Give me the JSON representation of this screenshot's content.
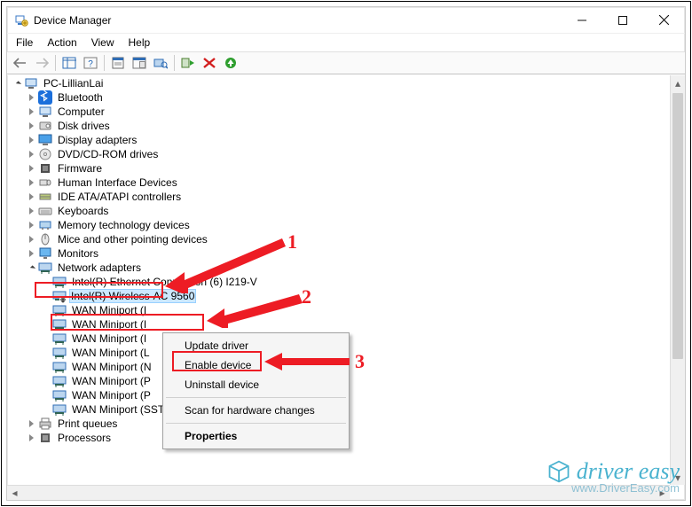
{
  "window": {
    "title": "Device Manager"
  },
  "menu": {
    "file": "File",
    "action": "Action",
    "view": "View",
    "help": "Help"
  },
  "tree": {
    "root": "PC-LillianLai",
    "cats": [
      "Bluetooth",
      "Computer",
      "Disk drives",
      "Display adapters",
      "DVD/CD-ROM drives",
      "Firmware",
      "Human Interface Devices",
      "IDE ATA/ATAPI controllers",
      "Keyboards",
      "Memory technology devices",
      "Mice and other pointing devices",
      "Monitors"
    ],
    "net_label": "Network adapters",
    "net_children": [
      "Intel(R) Ethernet Connection (6) I219-V",
      "Intel(R) Wireless-AC 9560",
      "WAN Miniport (I",
      "WAN Miniport (I",
      "WAN Miniport (I",
      "WAN Miniport (L",
      "WAN Miniport (N",
      "WAN Miniport (P",
      "WAN Miniport (P",
      "WAN Miniport (SSTP)"
    ],
    "tail_cats": [
      "Print queues",
      "Processors"
    ]
  },
  "ctx": {
    "update": "Update driver",
    "enable": "Enable device",
    "uninstall": "Uninstall device",
    "scan": "Scan for hardware changes",
    "props": "Properties"
  },
  "callouts": {
    "n1": "1",
    "n2": "2",
    "n3": "3"
  },
  "watermark": {
    "brand": "driver easy",
    "url": "www.DriverEasy.com"
  }
}
